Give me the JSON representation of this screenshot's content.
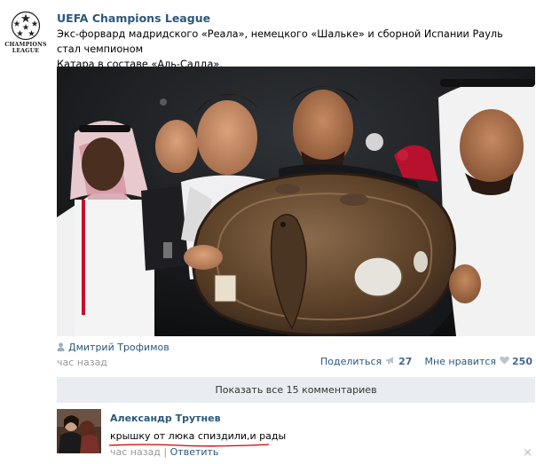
{
  "post": {
    "author": "UEFA Champions League",
    "logo_text_1": "CHAMPIONS",
    "logo_text_2": "LEAGUE",
    "text_line1": "Экс-форвард мадридского «Реала», немецкого «Шальке» и сборной Испании Рауль стал чемпионом",
    "text_line2": "Катара в составе «Аль-Садда».",
    "signed_by": "Дмитрий Трофимов",
    "time": "час назад",
    "share_label": "Поделиться",
    "share_count": "27",
    "like_label": "Мне нравится",
    "like_count": "250"
  },
  "comments": {
    "show_all_label": "Показать все 15 комментариев",
    "items": [
      {
        "author": "Александр Трутнев",
        "text": "крышку от люка спиздили,и рады",
        "time": "час назад",
        "separator": "|",
        "reply_label": "Ответить",
        "close": "×"
      }
    ]
  },
  "colors": {
    "link": "#2b587a",
    "muted": "#999999",
    "bar_bg": "#e9edf1",
    "underline": "#d40000"
  },
  "icons": {
    "logo": "champions-league-starball-icon",
    "signed": "person-icon",
    "share": "megaphone-icon",
    "like": "heart-icon",
    "close": "close-icon"
  }
}
